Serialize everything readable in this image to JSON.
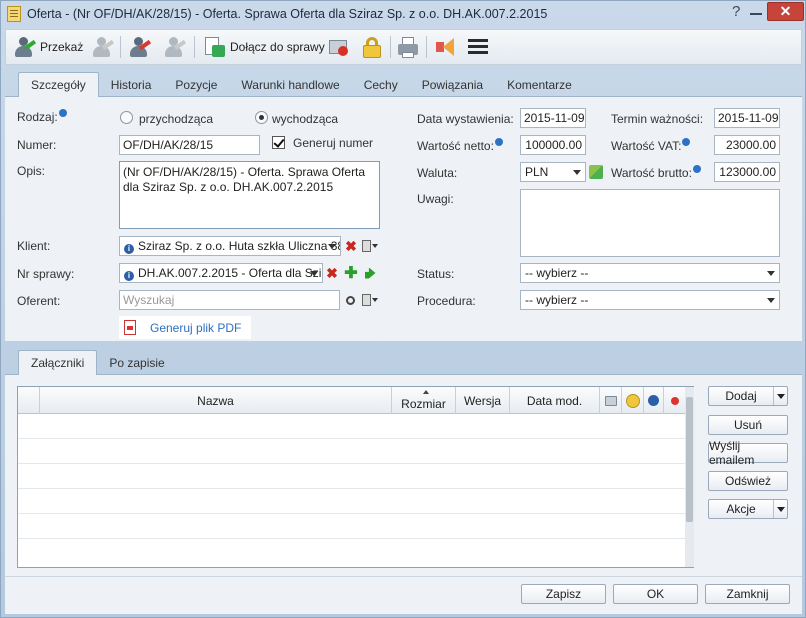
{
  "window": {
    "title": "Oferta - (Nr OF/DH/AK/28/15) - Oferta. Sprawa Oferta dla Sziraz Sp. z o.o. DH.AK.007.2.2015",
    "help": "?",
    "close": "✕"
  },
  "toolbar": {
    "forward_label": "Przekaż",
    "attach_label": "Dołącz do sprawy"
  },
  "tabs_top": [
    "Szczegóły",
    "Historia",
    "Pozycje",
    "Warunki handlowe",
    "Cechy",
    "Powiązania",
    "Komentarze"
  ],
  "form": {
    "rodzaj_label": "Rodzaj:",
    "rodzaj_options": [
      "przychodząca",
      "wychodząca"
    ],
    "rodzaj_selected": "wychodząca",
    "numer_label": "Numer:",
    "numer_value": "OF/DH/AK/28/15",
    "generuj_numer_label": "Generuj numer",
    "generuj_numer_checked": true,
    "opis_label": "Opis:",
    "opis_value": "(Nr OF/DH/AK/28/15) - Oferta. Sprawa Oferta dla Sziraz Sp. z o.o. DH.AK.007.2.2015",
    "klient_label": "Klient:",
    "klient_value": "Sziraz Sp. z o.o. Huta szkła Uliczna 38-",
    "nr_sprawy_label": "Nr sprawy:",
    "nr_sprawy_value": "DH.AK.007.2.2015 - Oferta dla Szir",
    "oferent_label": "Oferent:",
    "oferent_placeholder": "Wyszukaj",
    "pdf_link": "Generuj plik PDF",
    "data_wyst_label": "Data wystawienia:",
    "data_wyst_value": "2015-11-09",
    "termin_label": "Termin ważności:",
    "termin_value": "2015-11-09",
    "netto_label": "Wartość netto:",
    "netto_value": "100000.00",
    "vat_label": "Wartość VAT:",
    "vat_value": "23000.00",
    "waluta_label": "Waluta:",
    "waluta_value": "PLN",
    "brutto_label": "Wartość brutto:",
    "brutto_value": "123000.00",
    "uwagi_label": "Uwagi:",
    "status_label": "Status:",
    "status_value": "-- wybierz --",
    "procedura_label": "Procedura:",
    "procedura_value": "-- wybierz --"
  },
  "tabs_bottom": [
    "Załączniki",
    "Po zapisie"
  ],
  "grid": {
    "columns": [
      "Nazwa",
      "Rozmiar",
      "Wersja",
      "Data mod."
    ]
  },
  "side_buttons": {
    "dodaj": "Dodaj",
    "usun": "Usuń",
    "wyslij": "Wyślij emailem",
    "odswiez": "Odśwież",
    "akcje": "Akcje"
  },
  "footer": {
    "zapisz": "Zapisz",
    "ok": "OK",
    "zamknij": "Zamknij"
  },
  "colors": {
    "link": "#2f6fbf",
    "accent_info": "#2d72c4",
    "close": "#c7443a"
  }
}
